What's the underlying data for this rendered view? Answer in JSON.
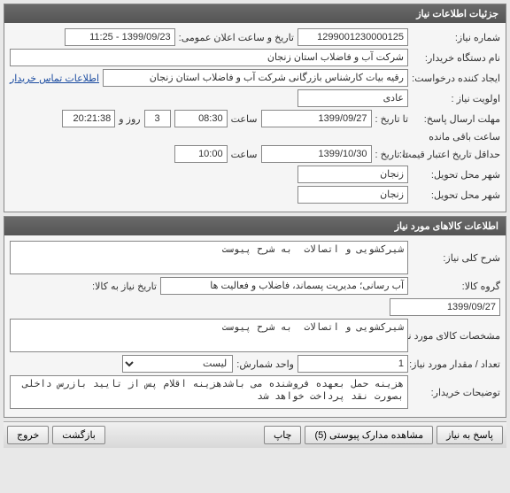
{
  "panels": {
    "need": {
      "title": "جزئیات اطلاعات نیاز",
      "need_no_label": "شماره نیاز:",
      "need_no": "1299001230000125",
      "public_datetime_label": "تاریخ و ساعت اعلان عمومی:",
      "public_datetime": "1399/09/23 - 11:25",
      "buyer_org_label": "نام دستگاه خریدار:",
      "buyer_org": "شرکت آب و فاضلاب استان زنجان",
      "requester_label": "ایجاد کننده درخواست:",
      "requester": "رقیه بیات کارشناس بازرگانی شرکت آب و فاضلاب استان زنجان",
      "contact_link": "اطلاعات تماس خریدار",
      "priority_label": "اولویت نیاز :",
      "priority": "عادی",
      "deadline_label": "مهلت ارسال پاسخ:",
      "to_date_label": "تا تاریخ :",
      "deadline_date": "1399/09/27",
      "deadline_time_label": "ساعت",
      "deadline_time": "08:30",
      "days_label": "روز و",
      "days": "3",
      "remain_time": "20:21:38",
      "remain_label": "ساعت باقی مانده",
      "min_credit_label": "حداقل تاریخ اعتبار قیمت:",
      "min_credit_date": "1399/10/30",
      "min_credit_time": "10:00",
      "delivery_city_label": "شهر محل تحویل:",
      "delivery_city": "زنجان",
      "delivery_city2_label": "شهر محل تحویل:",
      "delivery_city2": "زنجان"
    },
    "goods": {
      "title": "اطلاعات کالاهای مورد نیاز",
      "general_desc_label": "شرح کلی نیاز:",
      "general_desc": "شیرکشویی و اتصالات  به شرح پیوست",
      "group_label": "گروه کالا:",
      "group": "آب رسانی؛ مدیریت پسماند، فاضلاب و فعالیت ها",
      "need_date_label": "تاریخ نیاز به کالا:",
      "need_date": "1399/09/27",
      "spec_label": "مشخصات کالای مورد نیاز:",
      "spec": "شیرکشویی و اتصالات  به شرح پیوست",
      "qty_label": "تعداد / مقدار مورد نیاز:",
      "qty": "1",
      "unit_label": "واحد شمارش:",
      "unit": "لیست",
      "buyer_notes_label": "توضیحات خریدار:",
      "buyer_notes": "هزینه حمل بعهده فروشنده می باشدهزینه اقلام پس از تایید بازرس داخلی بصورت نقد پرداخت خواهد شد"
    }
  },
  "buttons": {
    "respond": "پاسخ به نیاز",
    "view_attach": "مشاهده مدارک پیوستی (5)",
    "print": "چاپ",
    "back": "بازگشت",
    "exit": "خروج"
  }
}
